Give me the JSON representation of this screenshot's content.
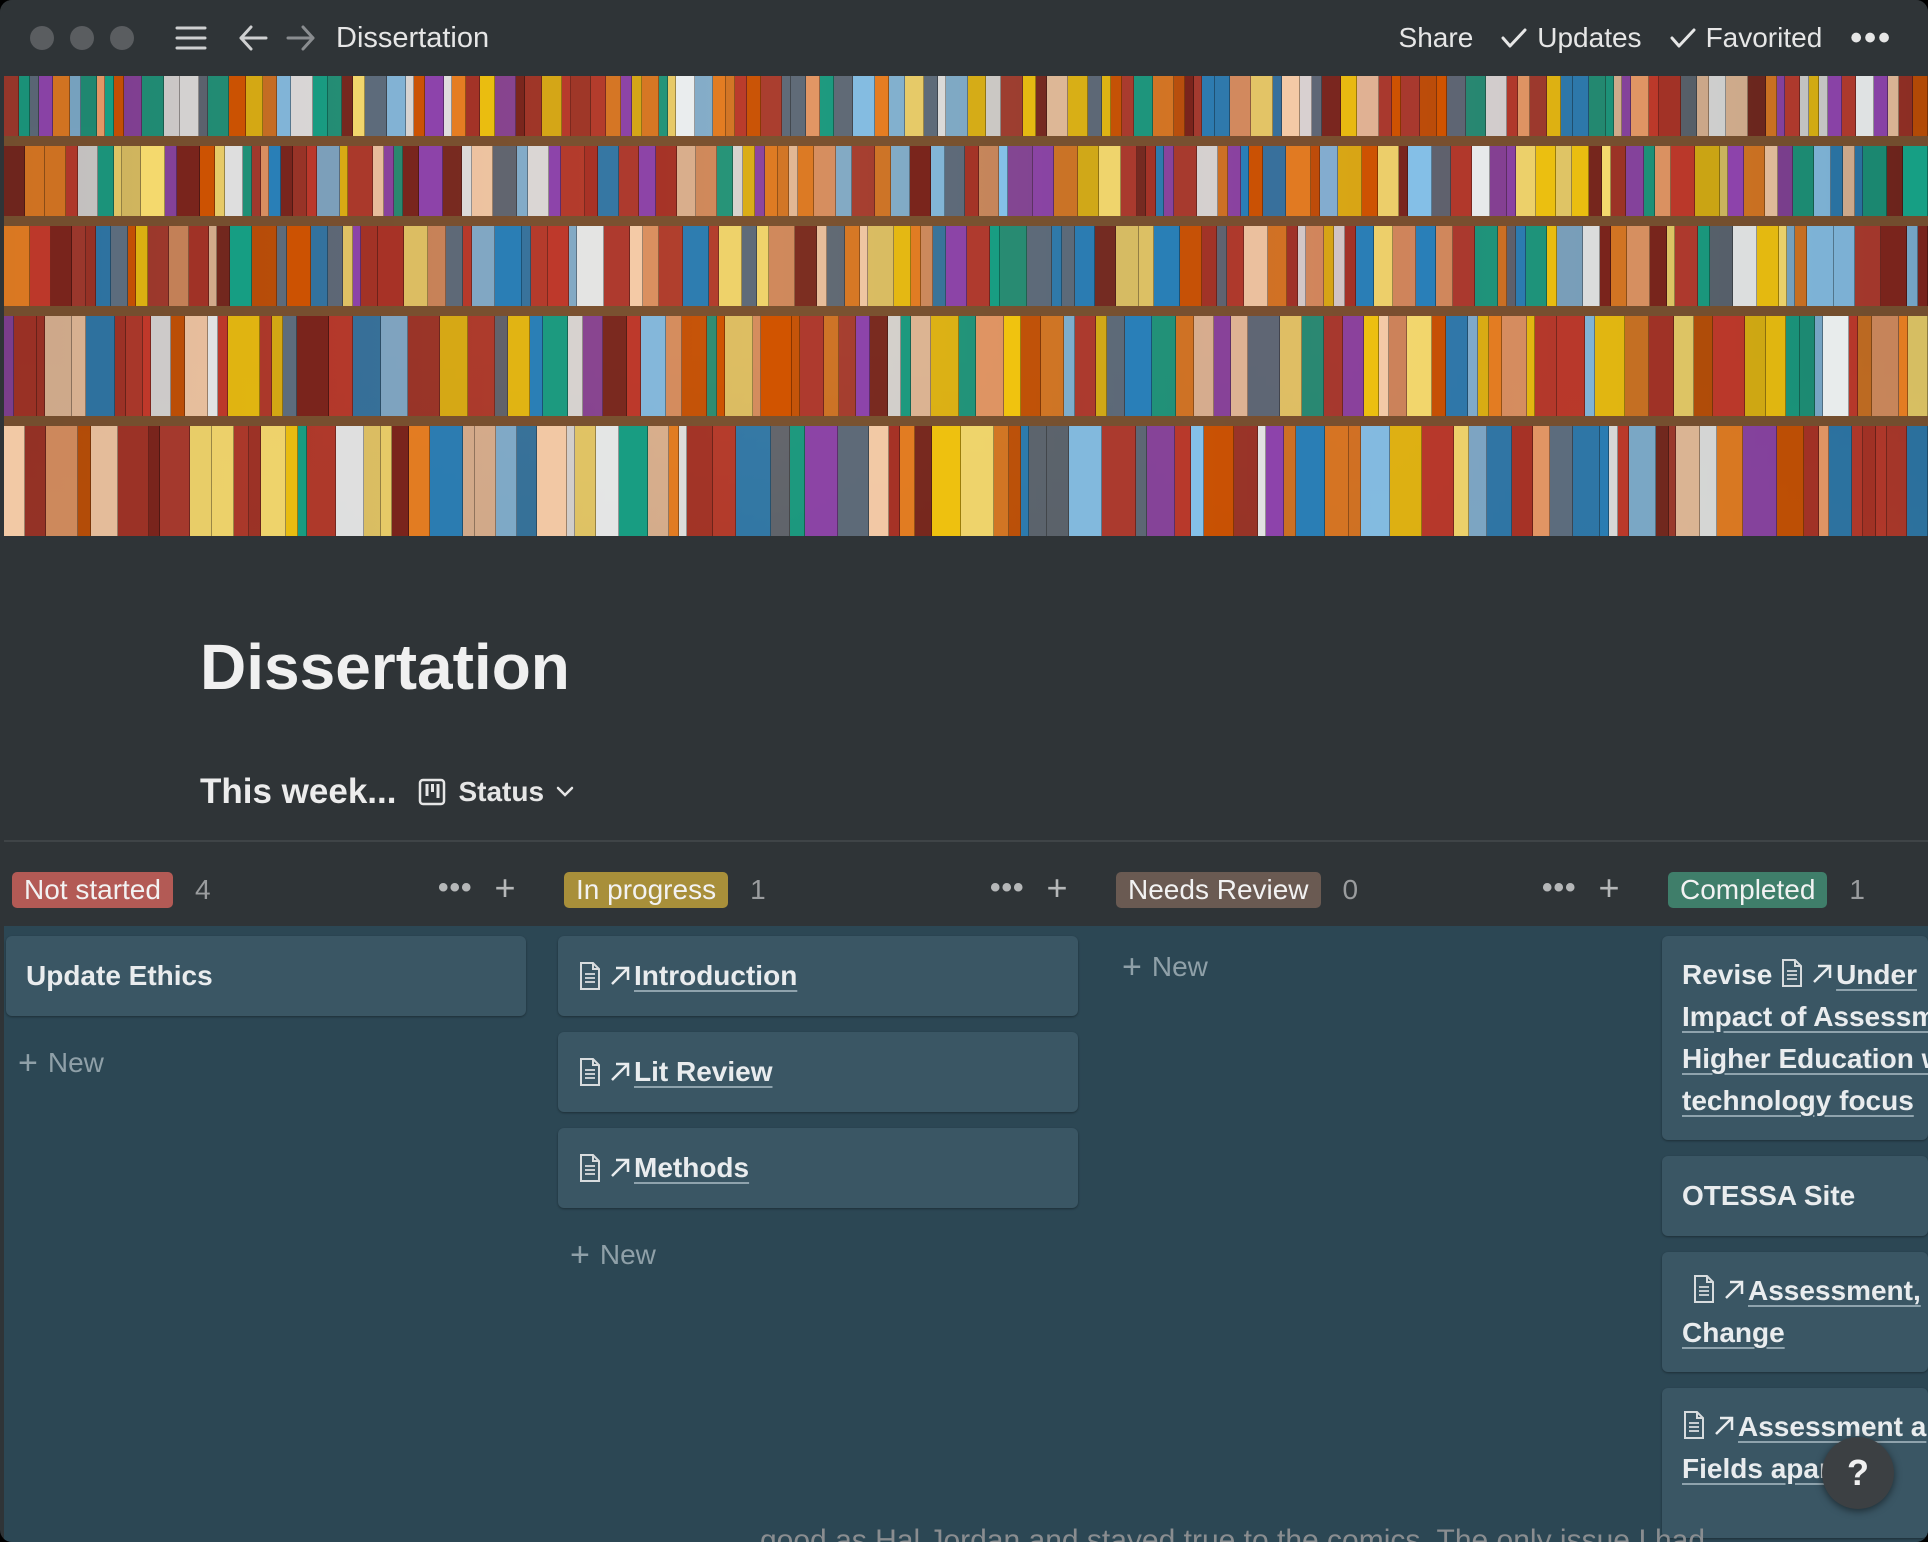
{
  "topbar": {
    "breadcrumb": "Dissertation",
    "share_label": "Share",
    "updates_label": "Updates",
    "favorited_label": "Favorited",
    "more_label": "•••"
  },
  "page": {
    "title": "Dissertation",
    "view_name": "This week...",
    "view_switch_label": "Status"
  },
  "columns": [
    {
      "label": "Not started",
      "count": "4",
      "color": "#b35a55"
    },
    {
      "label": "In progress",
      "count": "1",
      "color": "#a88f3a"
    },
    {
      "label": "Needs Review",
      "count": "0",
      "color": "#6a5a52"
    },
    {
      "label": "Completed",
      "count": "1",
      "color": "#3f7e6a"
    }
  ],
  "column_actions": {
    "dots": "•••",
    "plus": "+"
  },
  "cards": {
    "not_started": [
      {
        "title": "Update Ethics"
      }
    ],
    "in_progress": [
      {
        "title": "Introduction"
      },
      {
        "title": "Lit Review"
      },
      {
        "title": "Methods"
      }
    ],
    "completed": [
      {
        "prefix": "Revise",
        "title_line1": "Under",
        "title_line2": "Impact of Assessm",
        "title_line3": "Higher Education w",
        "title_line4": "technology focus"
      },
      {
        "title": "OTESSA Site"
      },
      {
        "title_line1": "Assessment,",
        "title_line2": "Change"
      },
      {
        "title_line1": "Assessment a",
        "title_line2": "Fields apar"
      }
    ]
  },
  "new_label": "New",
  "help_label": "?",
  "bottom_peek_text": "good as Hal Jordan and stayed true to the comics. The only issue I had"
}
